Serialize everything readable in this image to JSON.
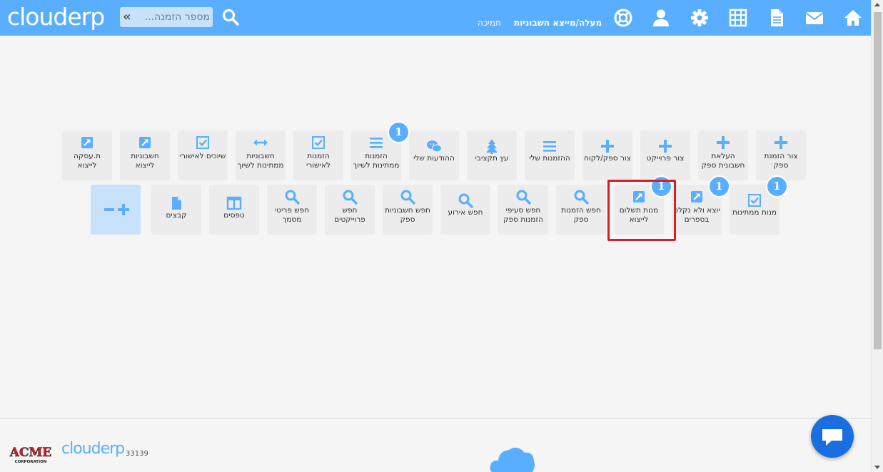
{
  "header": {
    "logo": "clouderp",
    "search_placeholder": "מספר הזמנה...",
    "links": {
      "current_user": "מעלה/מייצא חשבוניות",
      "support": "תמיכה"
    },
    "icons": [
      "search-icon",
      "home-icon",
      "envelope-icon",
      "document-icon",
      "calculator-icon",
      "gear-icon",
      "user-icon",
      "lifebuoy-icon"
    ]
  },
  "tiles_row1": [
    {
      "id": "create-supplier-order",
      "label": "צור הזמנת ספק",
      "icon": "plus-icon"
    },
    {
      "id": "upload-supplier-invoice",
      "label": "העלאת חשבונית ספק",
      "icon": "plus-icon"
    },
    {
      "id": "create-project",
      "label": "צור פרוייקט",
      "icon": "plus-icon"
    },
    {
      "id": "create-supplier-customer",
      "label": "צור ספק/לקוח",
      "icon": "plus-icon"
    },
    {
      "id": "my-orders",
      "label": "ההזמנות שלי",
      "icon": "list-icon"
    },
    {
      "id": "budget-tree",
      "label": "עץ תקציבי",
      "icon": "tree-icon"
    },
    {
      "id": "my-messages",
      "label": "ההודעות שלי",
      "icon": "chat-bubbles-icon"
    },
    {
      "id": "orders-pending-match",
      "label": "הזמנות ממתינות לשיוך",
      "icon": "list-icon",
      "badge": "1"
    },
    {
      "id": "orders-for-approval",
      "label": "הזמנות לאישורי",
      "icon": "checkbox-icon"
    },
    {
      "id": "invoices-pending-match",
      "label": "חשבוניות ממתינות לשיוך",
      "icon": "arrows-horizontal-icon"
    },
    {
      "id": "matches-for-approval",
      "label": "שיוכים לאישורי",
      "icon": "checkbox-icon"
    },
    {
      "id": "invoices-to-export",
      "label": "חשבוניות לייצוא",
      "icon": "export-icon"
    },
    {
      "id": "transactions-to-export",
      "label": "ת.עסקה לייצוא",
      "icon": "export-icon"
    }
  ],
  "tiles_row2": [
    {
      "id": "pending-batches",
      "label": "מנות ממתינות",
      "icon": "checkbox-icon",
      "badge": "1"
    },
    {
      "id": "exported-not-recorded",
      "label": "יוצא ולא נקלט בספרים",
      "icon": "export-icon",
      "badge": "1"
    },
    {
      "id": "payment-batches-to-export",
      "label": "מנות תשלום לייצוא",
      "icon": "export-icon",
      "badge": "1"
    },
    {
      "id": "search-supplier-orders",
      "label": "חפש הזמנות ספק",
      "icon": "search-icon"
    },
    {
      "id": "search-supplier-order-lines",
      "label": "חפש סעיפי הזמנות ספק",
      "icon": "search-icon"
    },
    {
      "id": "search-event",
      "label": "חפש אירוע",
      "icon": "search-icon"
    },
    {
      "id": "search-supplier-invoices",
      "label": "חפש חשבוניות ספק",
      "icon": "search-icon"
    },
    {
      "id": "search-projects",
      "label": "חפש פרוייקטים",
      "icon": "search-icon"
    },
    {
      "id": "search-document-details",
      "label": "חפש פריטי מסמך",
      "icon": "search-icon"
    },
    {
      "id": "forms",
      "label": "טפסים",
      "icon": "table-icon"
    },
    {
      "id": "files",
      "label": "קבצים",
      "icon": "file-icon"
    }
  ],
  "add_tile_icon": "minus-plus-icon",
  "footer": {
    "company_logo": "ACME CORPORATION",
    "logo": "clouderp",
    "version": "33139"
  },
  "colors": {
    "header": "#5aaeff",
    "accent": "#5aaeff",
    "tile_bg": "#ececec",
    "highlight": "#d81e24",
    "chat": "#1a6fe0"
  }
}
